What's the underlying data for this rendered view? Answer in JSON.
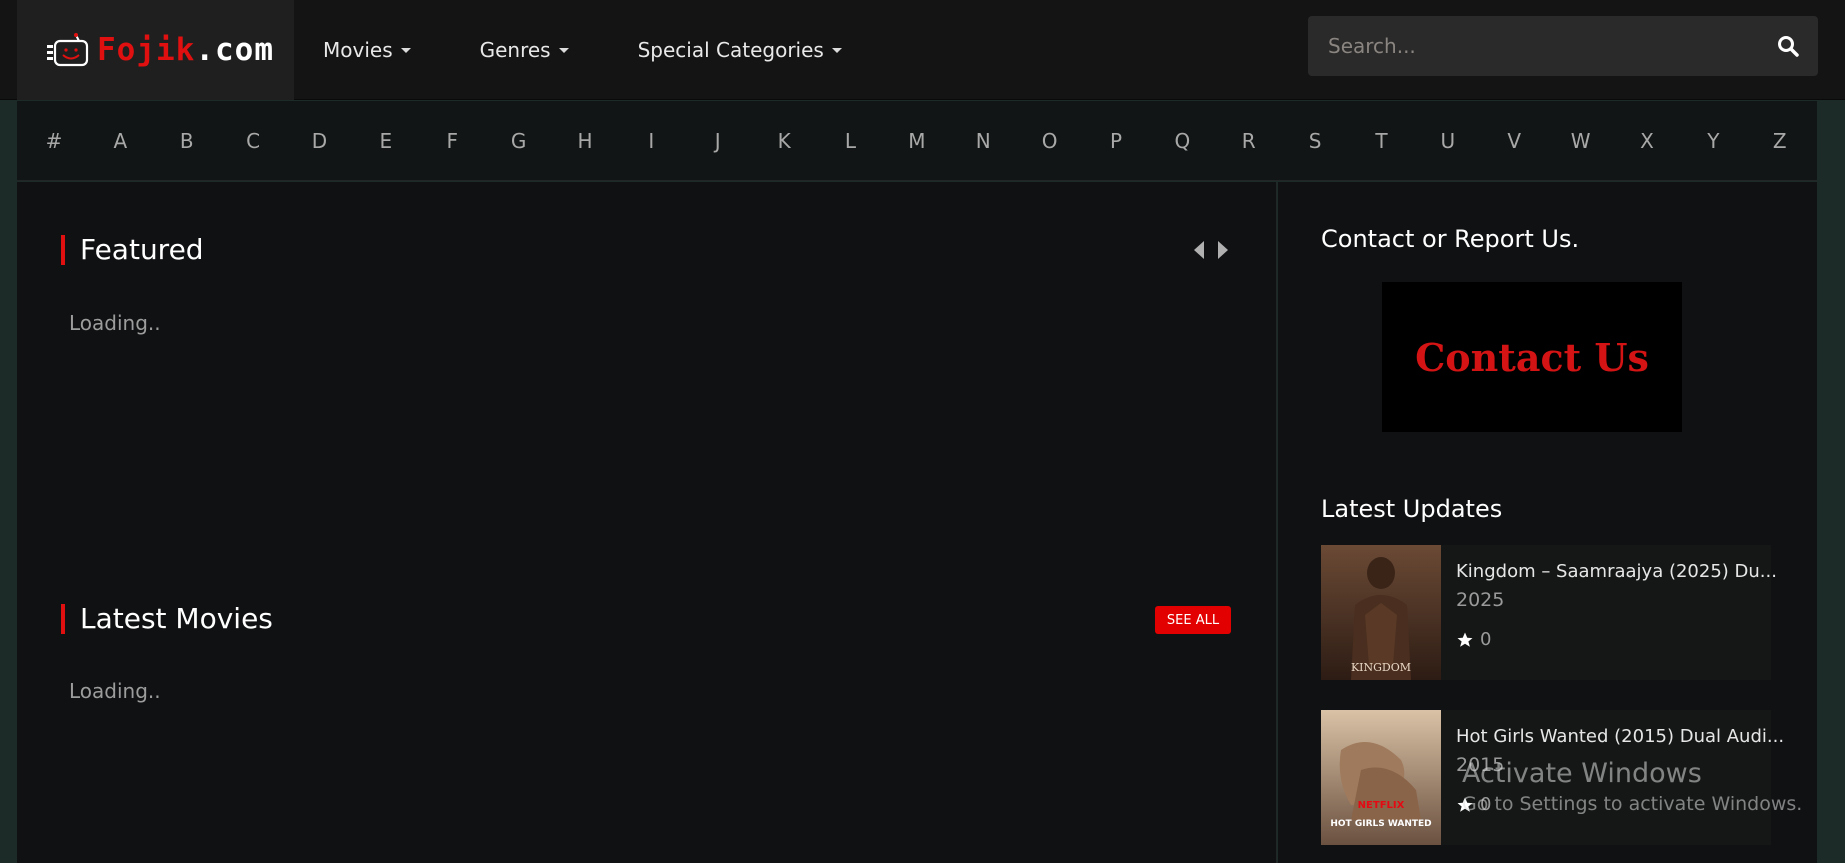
{
  "header": {
    "logo": {
      "part1": "Fojik",
      "part2": ".com"
    },
    "nav": [
      {
        "label": "Movies"
      },
      {
        "label": "Genres"
      },
      {
        "label": "Special Categories"
      }
    ],
    "search": {
      "placeholder": "Search...",
      "value": ""
    }
  },
  "alphabet": [
    "#",
    "A",
    "B",
    "C",
    "D",
    "E",
    "F",
    "G",
    "H",
    "I",
    "J",
    "K",
    "L",
    "M",
    "N",
    "O",
    "P",
    "Q",
    "R",
    "S",
    "T",
    "U",
    "V",
    "W",
    "X",
    "Y",
    "Z"
  ],
  "main": {
    "featured": {
      "title": "Featured",
      "loading": "Loading.."
    },
    "latest_movies": {
      "title": "Latest Movies",
      "see_all": "SEE ALL",
      "loading": "Loading.."
    }
  },
  "sidebar": {
    "contact_title": "Contact or Report Us.",
    "contact_banner": "Contact Us",
    "updates_title": "Latest Updates",
    "updates": [
      {
        "title": "Kingdom – Saamraajya (2025) Du...",
        "year": "2025",
        "rating": "0",
        "poster_text": "KINGDOM"
      },
      {
        "title": "Hot Girls Wanted (2015) Dual Audi...",
        "year": "2015",
        "rating": "0",
        "poster_brand": "NETFLIX",
        "poster_text": "HOT GIRLS WANTED"
      }
    ]
  },
  "watermark": {
    "line1": "Activate Windows",
    "line2": "Go to Settings to activate Windows."
  },
  "colors": {
    "accent": "#e01010",
    "background": "#0f1112",
    "header": "#141414"
  }
}
